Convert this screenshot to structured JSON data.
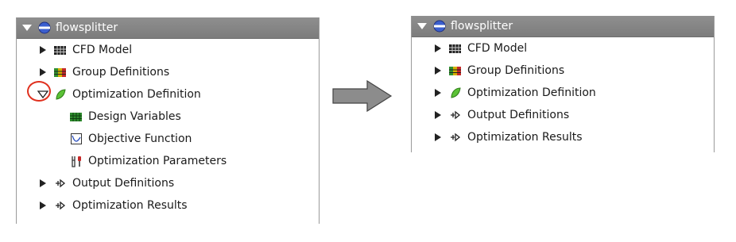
{
  "left_tree": {
    "root": "flowsplitter",
    "items": [
      {
        "label": "CFD Model",
        "icon": "grid-mesh-icon",
        "expanded": false
      },
      {
        "label": "Group Definitions",
        "icon": "colored-mesh-icon",
        "expanded": false
      },
      {
        "label": "Optimization Definition",
        "icon": "green-leaf-icon",
        "expanded": true,
        "children": [
          {
            "label": "Design Variables",
            "icon": "green-mesh-icon"
          },
          {
            "label": "Objective Function",
            "icon": "function-graph-icon"
          },
          {
            "label": "Optimization Parameters",
            "icon": "tools-icon"
          }
        ]
      },
      {
        "label": "Output Definitions",
        "icon": "output-arrow-icon",
        "expanded": false
      },
      {
        "label": "Optimization Results",
        "icon": "output-arrow-icon",
        "expanded": false
      }
    ]
  },
  "right_tree": {
    "root": "flowsplitter",
    "items": [
      {
        "label": "CFD Model",
        "icon": "grid-mesh-icon",
        "expanded": false
      },
      {
        "label": "Group Definitions",
        "icon": "colored-mesh-icon",
        "expanded": false
      },
      {
        "label": "Optimization Definition",
        "icon": "green-leaf-icon",
        "expanded": false
      },
      {
        "label": "Output Definitions",
        "icon": "output-arrow-icon",
        "expanded": false
      },
      {
        "label": "Optimization Results",
        "icon": "output-arrow-icon",
        "expanded": false
      }
    ]
  },
  "colors": {
    "titlebar": "#858585",
    "highlight_circle": "#e0301e",
    "arrow_fill": "#8c8c8c"
  }
}
